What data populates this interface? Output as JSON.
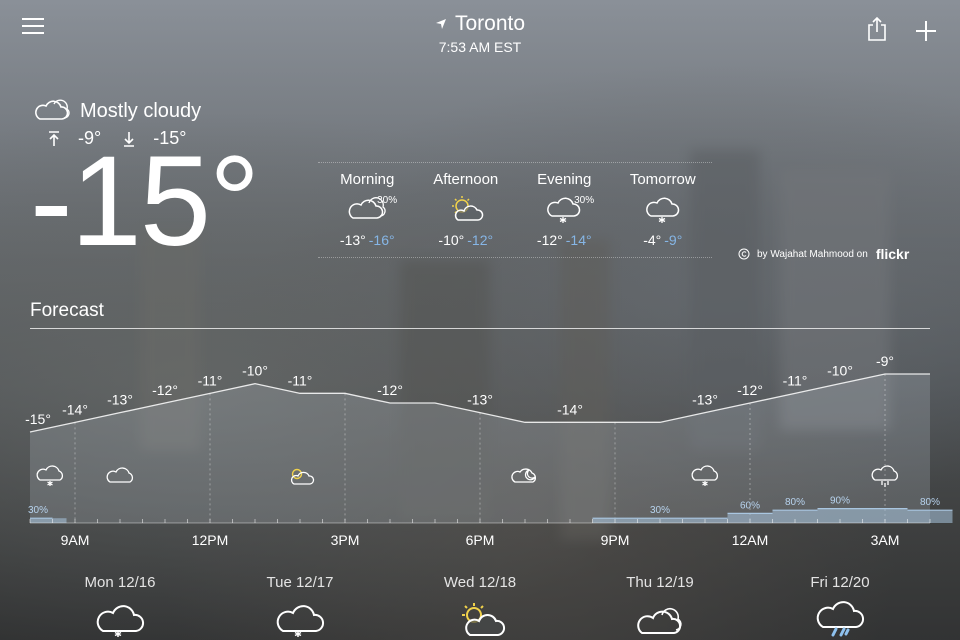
{
  "header": {
    "menu_icon": "hamburger-menu-icon",
    "location_icon": "location-arrow-icon",
    "city": "Toronto",
    "time": "7:53 AM EST",
    "share_icon": "share-icon",
    "add_icon": "plus-icon"
  },
  "current": {
    "condition": "Mostly cloudy",
    "condition_icon": "partly-cloudy-icon",
    "high": "-9°",
    "low": "-15°",
    "temperature": "-15°"
  },
  "periods": [
    {
      "name": "Morning",
      "icon": "partly-cloudy-icon",
      "precip": "30%",
      "high": "-13°",
      "low": "-16°"
    },
    {
      "name": "Afternoon",
      "icon": "partly-sunny-icon",
      "precip": "",
      "high": "-10°",
      "low": "-12°"
    },
    {
      "name": "Evening",
      "icon": "snow-cloud-icon",
      "precip": "30%",
      "high": "-12°",
      "low": "-14°"
    },
    {
      "name": "Tomorrow",
      "icon": "snow-cloud-icon",
      "precip": "",
      "high": "-4°",
      "low": "-9°"
    }
  ],
  "photo_credit": {
    "icon": "copyright-icon",
    "text": "by Wajahat Mahmood on",
    "brand": "flickr"
  },
  "forecast": {
    "title": "Forecast"
  },
  "chart_data": {
    "type": "area",
    "x": [
      "8AM",
      "9AM",
      "10AM",
      "11AM",
      "12PM",
      "1PM",
      "2PM",
      "3PM",
      "4PM",
      "5PM",
      "6PM",
      "7PM",
      "8PM",
      "9PM",
      "10PM",
      "11PM",
      "12AM",
      "1AM",
      "2AM",
      "3AM",
      "4AM"
    ],
    "time_ticks": [
      "9AM",
      "12PM",
      "3PM",
      "6PM",
      "9PM",
      "12AM",
      "3AM"
    ],
    "temperature": [
      -15,
      -14,
      -13,
      -12,
      -11,
      -10,
      -11,
      -11,
      -12,
      -12,
      -13,
      -14,
      -14,
      -14,
      -14,
      -13,
      -12,
      -11,
      -10,
      -9,
      -9
    ],
    "temperature_labels": [
      "-15°",
      "-14°",
      "-13°",
      "-12°",
      "-11°",
      "-10°",
      "-11°",
      "",
      "-12°",
      "",
      "-13°",
      "",
      "-14°",
      "",
      "",
      "-13°",
      "-12°",
      "-11°",
      "-10°",
      "-9°",
      ""
    ],
    "precip_pct": [
      30,
      0,
      0,
      0,
      0,
      0,
      0,
      0,
      0,
      0,
      0,
      0,
      0,
      30,
      30,
      30,
      60,
      80,
      90,
      90,
      80
    ],
    "precip_labels": [
      "30%",
      "",
      "",
      "",
      "",
      "",
      "",
      "",
      "",
      "",
      "",
      "",
      "",
      "",
      "30%",
      "",
      "60%",
      "80%",
      "90%",
      "",
      "80%"
    ],
    "icons": [
      {
        "hour": "8AM",
        "name": "snow-cloud-icon"
      },
      {
        "hour": "10AM",
        "name": "cloud-icon"
      },
      {
        "hour": "2PM",
        "name": "partly-sunny-icon"
      },
      {
        "hour": "7PM",
        "name": "moon-cloud-icon"
      },
      {
        "hour": "11PM",
        "name": "snow-cloud-icon"
      },
      {
        "hour": "3AM",
        "name": "snow-heavy-icon"
      }
    ]
  },
  "days": [
    {
      "label": "Mon 12/16",
      "icon": "snow-cloud-icon"
    },
    {
      "label": "Tue 12/17",
      "icon": "snow-cloud-icon"
    },
    {
      "label": "Wed 12/18",
      "icon": "partly-sunny-icon"
    },
    {
      "label": "Thu 12/19",
      "icon": "cloud-icon"
    },
    {
      "label": "Fri 12/20",
      "icon": "rain-cloud-icon"
    }
  ],
  "colors": {
    "low_temp": "#86b6e6",
    "precip_bar": "#a9c6e0",
    "sun": "#f1d24b"
  }
}
